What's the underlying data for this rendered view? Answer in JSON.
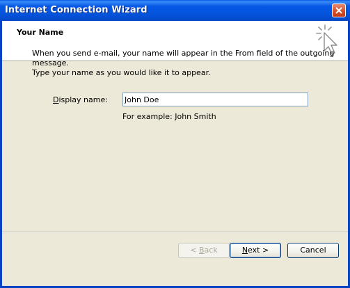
{
  "window": {
    "title": "Internet Connection Wizard"
  },
  "header": {
    "title": "Your Name"
  },
  "description": {
    "line1": "When you send e-mail, your name will appear in the From field of the outgoing message.",
    "line2": "Type your name as you would like it to appear."
  },
  "form": {
    "display_name_label_mnemonic": "D",
    "display_name_label_rest": "isplay name:",
    "display_name_value": "John Doe",
    "example_text": "For example: John Smith"
  },
  "buttons": {
    "back_prefix": "< ",
    "back_mnemonic": "B",
    "back_rest": "ack",
    "next_mnemonic": "N",
    "next_rest": "ext >",
    "cancel_label": "Cancel"
  },
  "colors": {
    "titlebar": "#0558E6",
    "dialog_bg": "#ECE9D8",
    "header_bg": "#FFFFFF",
    "close_button": "#D64A24"
  },
  "icons": {
    "close": "close-icon",
    "wizard": "wizard-cursor-icon"
  }
}
